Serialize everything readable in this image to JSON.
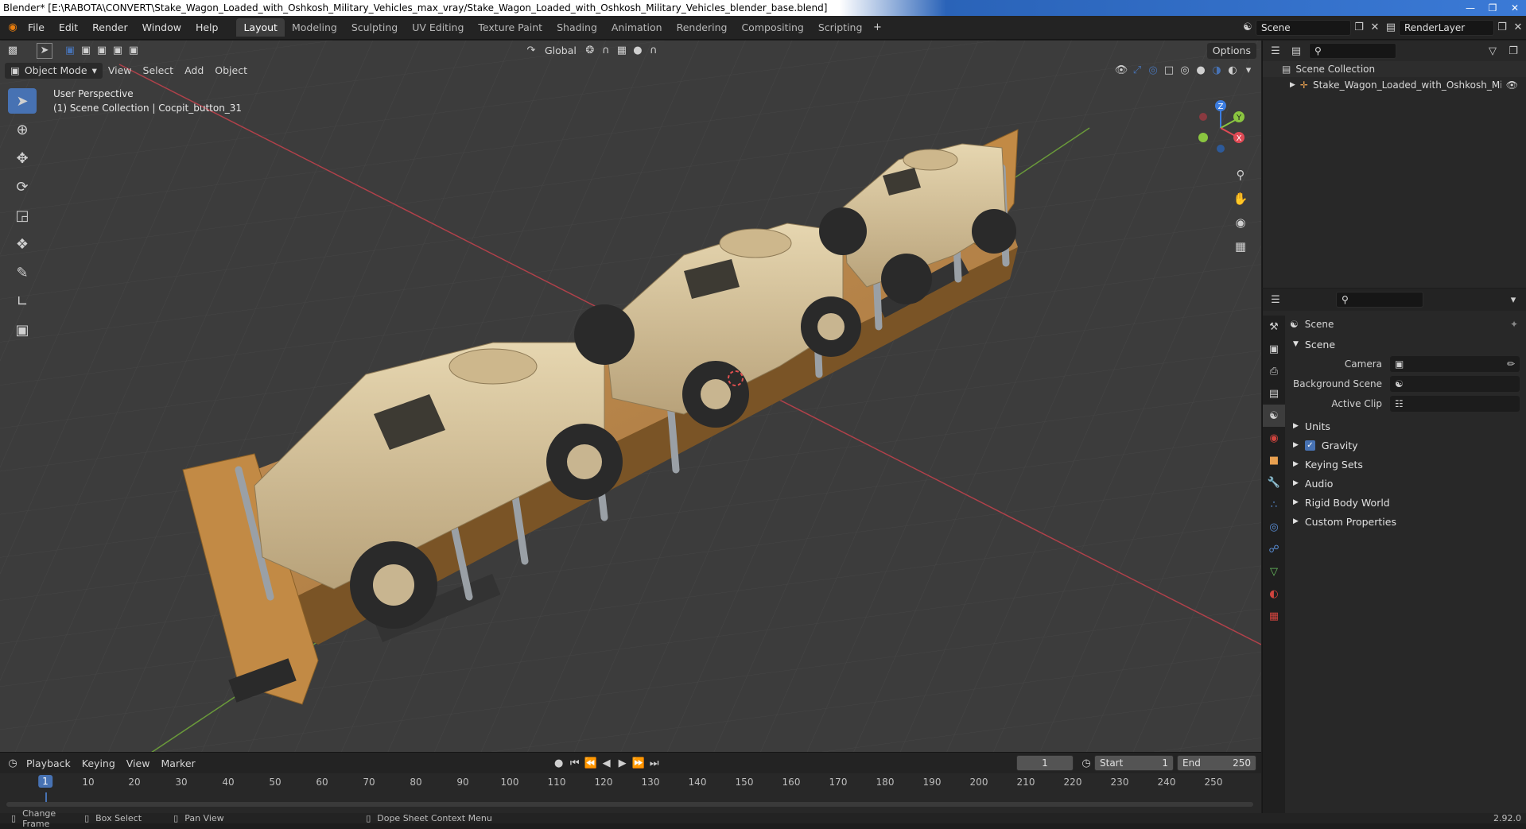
{
  "titlebar": {
    "title": "Blender* [E:\\RABOTA\\CONVERT\\Stake_Wagon_Loaded_with_Oshkosh_Military_Vehicles_max_vray/Stake_Wagon_Loaded_with_Oshkosh_Military_Vehicles_blender_base.blend]"
  },
  "menu": [
    "File",
    "Edit",
    "Render",
    "Window",
    "Help"
  ],
  "workspaces": [
    "Layout",
    "Modeling",
    "Sculpting",
    "UV Editing",
    "Texture Paint",
    "Shading",
    "Animation",
    "Rendering",
    "Compositing",
    "Scripting"
  ],
  "active_workspace": "Layout",
  "top_right": {
    "scene": "Scene",
    "render_layer": "RenderLayer"
  },
  "viewport": {
    "transform_orientation": "Global",
    "options_label": "Options",
    "mode": "Object Mode",
    "header_menus": [
      "View",
      "Select",
      "Add",
      "Object"
    ],
    "perspective": "User Perspective",
    "collection_info": "(1) Scene Collection | Cocpit_button_31",
    "gizmo_axes": {
      "z": "Z",
      "y": "Y",
      "x": "X"
    }
  },
  "timeline": {
    "menus": [
      "Playback",
      "Keying",
      "View",
      "Marker"
    ],
    "current_frame": "1",
    "start_label": "Start",
    "start": "1",
    "end_label": "End",
    "end": "250",
    "ruler": [
      "10",
      "20",
      "30",
      "40",
      "50",
      "60",
      "70",
      "80",
      "90",
      "100",
      "110",
      "120",
      "130",
      "140",
      "150",
      "160",
      "170",
      "180",
      "190",
      "200",
      "210",
      "220",
      "230",
      "240",
      "250"
    ],
    "playhead": "1"
  },
  "outliner": {
    "root": "Scene Collection",
    "items": [
      "Stake_Wagon_Loaded_with_Oshkosh_Militar"
    ]
  },
  "properties": {
    "context": "Scene",
    "section": "Scene",
    "fields": [
      {
        "label": "Camera",
        "value": ""
      },
      {
        "label": "Background Scene",
        "value": ""
      },
      {
        "label": "Active Clip",
        "value": ""
      }
    ],
    "panels": [
      "Units",
      "Gravity",
      "Keying Sets",
      "Audio",
      "Rigid Body World",
      "Custom Properties"
    ]
  },
  "statusbar": {
    "items": [
      "Change Frame",
      "Box Select",
      "Pan View",
      "Dope Sheet Context Menu"
    ],
    "version": "2.92.0"
  },
  "colors": {
    "accent": "#4772b3",
    "vehicle": "#d8c49a",
    "wagon": "#b8864a",
    "grid_x": "#b0414a",
    "grid_y": "#6a9a3a"
  }
}
